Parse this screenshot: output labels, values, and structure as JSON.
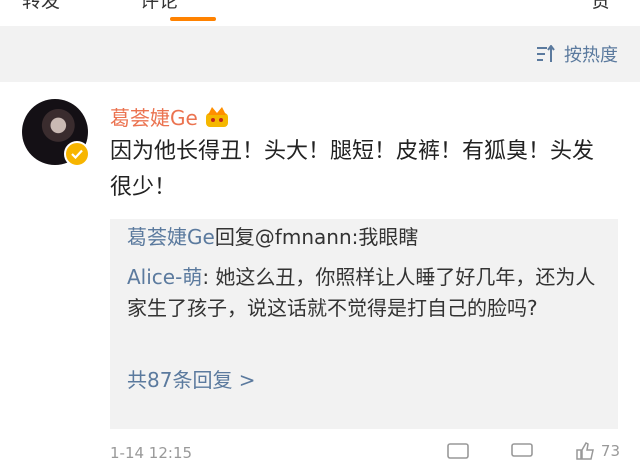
{
  "tabs": {
    "left": "转发",
    "active": "评论",
    "right": "赞"
  },
  "sort": {
    "label": "按热度"
  },
  "comment": {
    "username": "葛荟婕Ge",
    "text": "因为他长得丑！头大！腿短！皮裤！有狐臭！头发很少！",
    "time": "1-14 12:15",
    "like_count": "73"
  },
  "replies": {
    "r1": {
      "user": "葛荟婕Ge",
      "text": "回复@fmnann:我眼瞎"
    },
    "r2": {
      "user": "Alice-萌",
      "text": ": 她这么丑，你照样让人睡了好几年，还为人家生了孩子，说这话就不觉得是打自己的脸吗?"
    },
    "more": "共87条回复 >"
  },
  "icons": {
    "sort": "sort-icon",
    "verify": "verified-badge-icon",
    "vip": "vip-crown-icon",
    "share": "share-icon",
    "comment": "comment-icon",
    "like": "like-icon"
  },
  "colors": {
    "accent": "#ff8200",
    "link": "#5b7a9e",
    "username": "#eb7350",
    "panel": "#f2f2f2"
  }
}
